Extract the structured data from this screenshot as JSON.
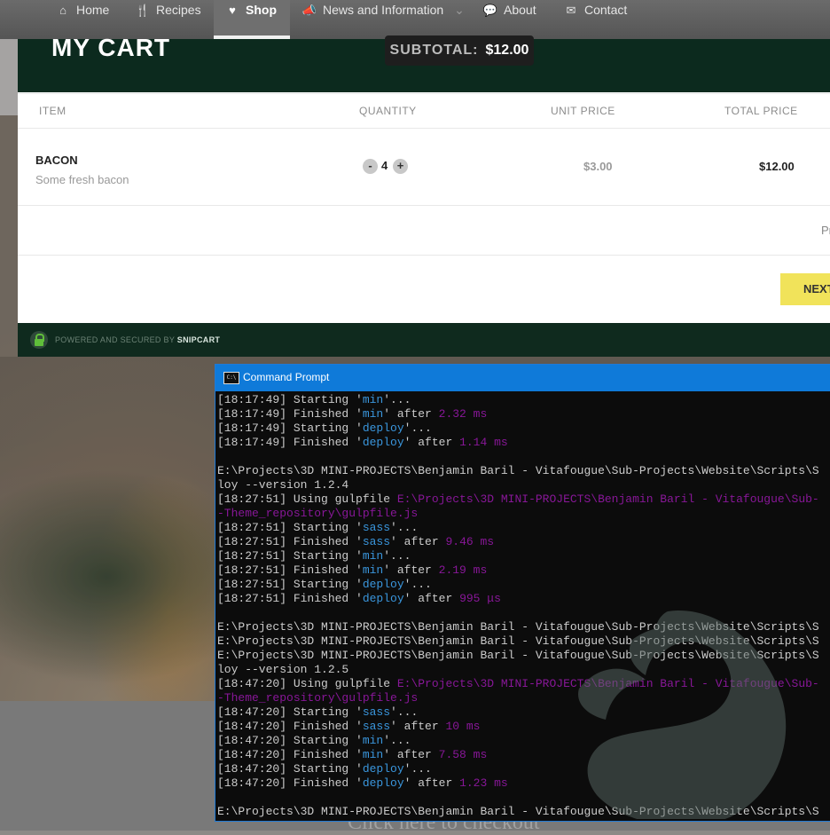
{
  "nav": {
    "items": [
      {
        "icon": "home-icon",
        "glyph": "⌂",
        "label": "Home"
      },
      {
        "icon": "recipes-icon",
        "glyph": "🍴",
        "label": "Recipes"
      },
      {
        "icon": "heart-icon",
        "glyph": "♥",
        "label": "Shop"
      },
      {
        "icon": "megaphone-icon",
        "glyph": "📣",
        "label": "News and Information"
      },
      {
        "icon": "chat-icon",
        "glyph": "💬",
        "label": "About"
      },
      {
        "icon": "mail-icon",
        "glyph": "✉",
        "label": "Contact"
      }
    ],
    "dropdown_glyph": "⌄"
  },
  "cart": {
    "title": "MY CART",
    "subtotal_label": "SUBTOTAL:",
    "subtotal_value": "$12.00",
    "columns": [
      "ITEM",
      "QUANTITY",
      "UNIT PRICE",
      "TOTAL PRICE"
    ],
    "item": {
      "name": "BACON",
      "description": "Some fresh bacon",
      "quantity": "4",
      "decrement": "-",
      "increment": "+",
      "unit_price": "$3.00",
      "total_price": "$12.00"
    },
    "partial_text": "Pr",
    "next_label": "NEXT",
    "footer_text": "POWERED AND SECURED BY",
    "footer_brand": "SNIPCART"
  },
  "checkout_link": "Click here to checkout",
  "cmd": {
    "title": "Command Prompt",
    "icon_text": "C:\\",
    "lines": [
      [
        [
          "[18:17:49] Starting '",
          ""
        ],
        [
          "min",
          "task"
        ],
        [
          "'...",
          ""
        ]
      ],
      [
        [
          "[18:17:49] Finished '",
          ""
        ],
        [
          "min",
          "task"
        ],
        [
          "' after ",
          ""
        ],
        [
          "2.32 ms",
          "time"
        ]
      ],
      [
        [
          "[18:17:49] Starting '",
          ""
        ],
        [
          "deploy",
          "task"
        ],
        [
          "'...",
          ""
        ]
      ],
      [
        [
          "[18:17:49] Finished '",
          ""
        ],
        [
          "deploy",
          "task"
        ],
        [
          "' after ",
          ""
        ],
        [
          "1.14 ms",
          "time"
        ]
      ],
      [
        [
          "",
          ""
        ]
      ],
      [
        [
          "E:\\Projects\\3D MINI-PROJECTS\\Benjamin Baril - Vitafougue\\Sub-Projects\\Website\\Scripts\\S",
          ""
        ]
      ],
      [
        [
          "loy --version 1.2.4",
          ""
        ]
      ],
      [
        [
          "[18:27:51] Using gulpfile ",
          ""
        ],
        [
          "E:\\Projects\\3D MINI-PROJECTS\\Benjamin Baril - Vitafougue\\Sub-",
          "path"
        ]
      ],
      [
        [
          "-Theme_repository\\gulpfile.js",
          "path"
        ]
      ],
      [
        [
          "[18:27:51] Starting '",
          ""
        ],
        [
          "sass",
          "task"
        ],
        [
          "'...",
          ""
        ]
      ],
      [
        [
          "[18:27:51] Finished '",
          ""
        ],
        [
          "sass",
          "task"
        ],
        [
          "' after ",
          ""
        ],
        [
          "9.46 ms",
          "time"
        ]
      ],
      [
        [
          "[18:27:51] Starting '",
          ""
        ],
        [
          "min",
          "task"
        ],
        [
          "'...",
          ""
        ]
      ],
      [
        [
          "[18:27:51] Finished '",
          ""
        ],
        [
          "min",
          "task"
        ],
        [
          "' after ",
          ""
        ],
        [
          "2.19 ms",
          "time"
        ]
      ],
      [
        [
          "[18:27:51] Starting '",
          ""
        ],
        [
          "deploy",
          "task"
        ],
        [
          "'...",
          ""
        ]
      ],
      [
        [
          "[18:27:51] Finished '",
          ""
        ],
        [
          "deploy",
          "task"
        ],
        [
          "' after ",
          ""
        ],
        [
          "995 μs",
          "time"
        ]
      ],
      [
        [
          "",
          ""
        ]
      ],
      [
        [
          "E:\\Projects\\3D MINI-PROJECTS\\Benjamin Baril - Vitafougue\\Sub-Projects\\Website\\Scripts\\S",
          ""
        ]
      ],
      [
        [
          "E:\\Projects\\3D MINI-PROJECTS\\Benjamin Baril - Vitafougue\\Sub-Projects\\Website\\Scripts\\S",
          ""
        ]
      ],
      [
        [
          "E:\\Projects\\3D MINI-PROJECTS\\Benjamin Baril - Vitafougue\\Sub-Projects\\Website\\Scripts\\S",
          ""
        ]
      ],
      [
        [
          "loy --version 1.2.5",
          ""
        ]
      ],
      [
        [
          "[18:47:20] Using gulpfile ",
          ""
        ],
        [
          "E:\\Projects\\3D MINI-PROJECTS\\Benjamin Baril - Vitafougue\\Sub-",
          "path"
        ]
      ],
      [
        [
          "-Theme_repository\\gulpfile.js",
          "path"
        ]
      ],
      [
        [
          "[18:47:20] Starting '",
          ""
        ],
        [
          "sass",
          "task"
        ],
        [
          "'...",
          ""
        ]
      ],
      [
        [
          "[18:47:20] Finished '",
          ""
        ],
        [
          "sass",
          "task"
        ],
        [
          "' after ",
          ""
        ],
        [
          "10 ms",
          "time"
        ]
      ],
      [
        [
          "[18:47:20] Starting '",
          ""
        ],
        [
          "min",
          "task"
        ],
        [
          "'...",
          ""
        ]
      ],
      [
        [
          "[18:47:20] Finished '",
          ""
        ],
        [
          "min",
          "task"
        ],
        [
          "' after ",
          ""
        ],
        [
          "7.58 ms",
          "time"
        ]
      ],
      [
        [
          "[18:47:20] Starting '",
          ""
        ],
        [
          "deploy",
          "task"
        ],
        [
          "'...",
          ""
        ]
      ],
      [
        [
          "[18:47:20] Finished '",
          ""
        ],
        [
          "deploy",
          "task"
        ],
        [
          "' after ",
          ""
        ],
        [
          "1.23 ms",
          "time"
        ]
      ],
      [
        [
          "",
          ""
        ]
      ],
      [
        [
          "E:\\Projects\\3D MINI-PROJECTS\\Benjamin Baril - Vitafougue\\Sub-Projects\\Website\\Scripts\\S",
          ""
        ]
      ]
    ]
  },
  "colors": {
    "cart_header": "#0c2a1e",
    "next_button": "#f1e35a",
    "cmd_titlebar": "#0f7ad9",
    "task_text": "#3a96dd",
    "time_text": "#881798"
  }
}
